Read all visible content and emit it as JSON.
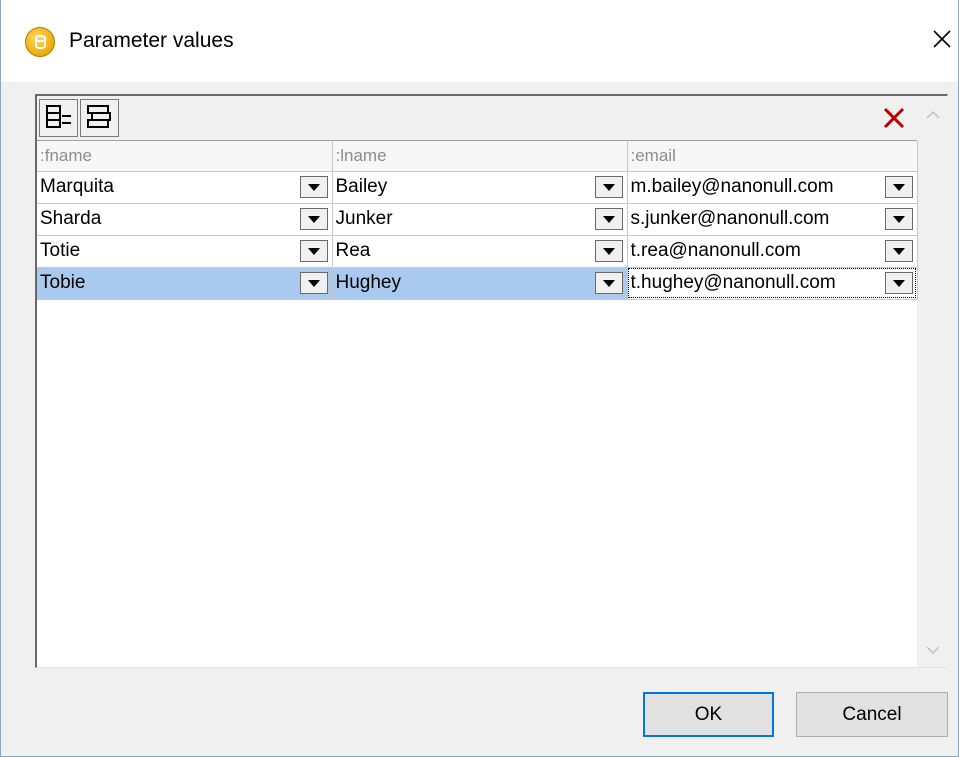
{
  "window": {
    "title": "Parameter values",
    "title_icon": "database-icon",
    "close_icon": "close-icon"
  },
  "toolbar": {
    "insert_row_icon": "insert-row-icon",
    "append_row_icon": "append-row-icon",
    "delete_icon": "delete-x-icon",
    "delete_color": "#c00000"
  },
  "table": {
    "columns": [
      ":fname",
      ":lname",
      ":email"
    ],
    "rows": [
      {
        "fname": "Marquita",
        "lname": "Bailey",
        "email": "m.bailey@nanonull.com"
      },
      {
        "fname": "Sharda",
        "lname": "Junker",
        "email": "s.junker@nanonull.com"
      },
      {
        "fname": "Totie",
        "lname": "Rea",
        "email": "t.rea@nanonull.com"
      },
      {
        "fname": "Tobie",
        "lname": "Hughey",
        "email": "t.hughey@nanonull.com"
      }
    ],
    "selected_row": 3,
    "selection_color": "#aac9ee"
  },
  "buttons": {
    "ok": "OK",
    "cancel": "Cancel"
  },
  "colors": {
    "focus_border": "#0078d7",
    "dialog_bg": "#f0f0f0"
  }
}
